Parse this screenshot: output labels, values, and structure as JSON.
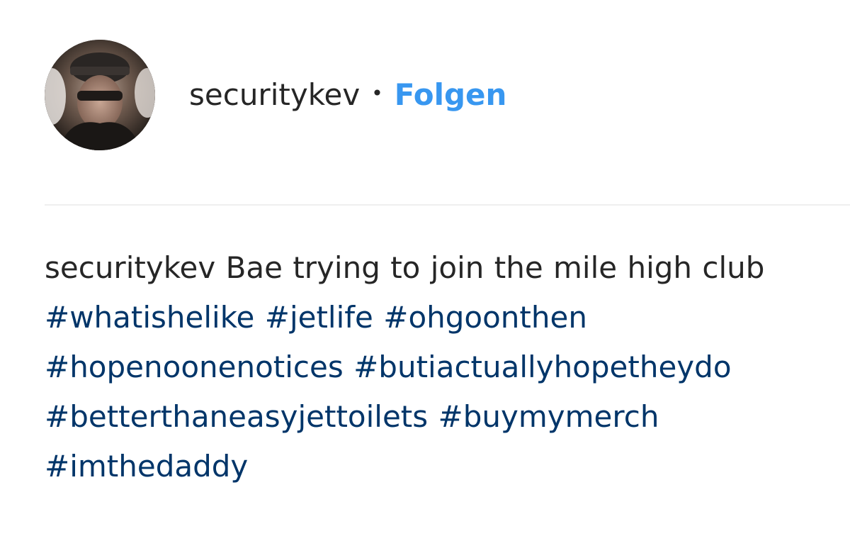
{
  "post": {
    "username": "securitykev",
    "separator": "•",
    "follow_label": "Folgen"
  },
  "caption": {
    "username": "securitykev",
    "text": "Bae trying to join the mile high club",
    "hashtags": [
      "#whatishelike",
      "#jetlife",
      "#ohgoonthen",
      "#hopenoonenotices",
      "#butiactuallyhopetheydo",
      "#betterthaneasyjettoilets",
      "#buymymerch",
      "#imthedaddy"
    ]
  },
  "colors": {
    "follow": "#3897f0",
    "hashtag": "#003569",
    "text": "#262626",
    "divider": "#efefef"
  }
}
